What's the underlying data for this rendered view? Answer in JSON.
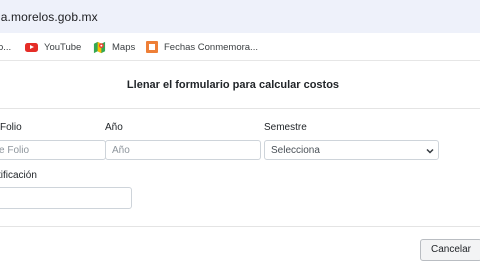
{
  "browser": {
    "url": "la.morelos.gob.mx",
    "bookmarks": [
      {
        "label": "o...",
        "icon": "none"
      },
      {
        "label": "YouTube",
        "icon": "youtube-icon"
      },
      {
        "label": "Maps",
        "icon": "maps-icon"
      },
      {
        "label": "Fechas Conmemora...",
        "icon": "bookmark-page-icon"
      }
    ]
  },
  "modal": {
    "title": "Llenar el formulario para calcular costos",
    "fields": {
      "folio": {
        "label": "Folio",
        "placeholder": "e Folio",
        "value": ""
      },
      "anio": {
        "label": "Año",
        "placeholder": "Año",
        "value": ""
      },
      "semestre": {
        "label": "Semestre",
        "selected": "Selecciona"
      },
      "identificacion": {
        "label": "tificación",
        "value": ""
      }
    },
    "footer": {
      "cancel_label": "Cancelar"
    }
  },
  "colors": {
    "address_bar_bg": "#eef1fa",
    "youtube_red": "#e52d27",
    "fechas_orange": "#ee7f37",
    "input_border": "#ced4da"
  }
}
